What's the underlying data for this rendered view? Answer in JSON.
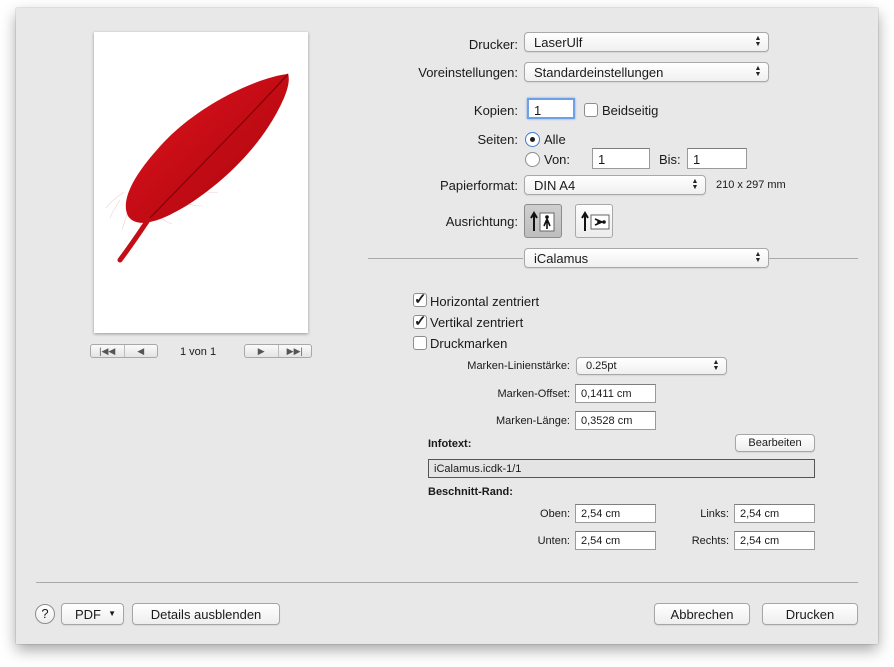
{
  "printer": {
    "label": "Drucker:",
    "value": "LaserUlf"
  },
  "presets": {
    "label": "Voreinstellungen:",
    "value": "Standardeinstellungen"
  },
  "copies": {
    "label": "Kopien:",
    "value": "1",
    "duplex_label": "Beidseitig",
    "duplex_checked": false
  },
  "pages": {
    "label": "Seiten:",
    "all_label": "Alle",
    "from_label": "Von:",
    "from_value": "1",
    "to_label": "Bis:",
    "to_value": "1",
    "selected": "all"
  },
  "paper": {
    "label": "Papierformat:",
    "value": "DIN A4",
    "size_text": "210 x 297 mm"
  },
  "orientation": {
    "label": "Ausrichtung:",
    "selected": "portrait"
  },
  "section_popup": {
    "value": "iCalamus"
  },
  "preview_nav": {
    "page_text": "1 von 1"
  },
  "options": {
    "horizontal_label": "Horizontal zentriert",
    "horizontal_checked": true,
    "vertical_label": "Vertikal zentriert",
    "vertical_checked": true,
    "marks_label": "Druckmarken",
    "marks_checked": false,
    "line_width_label": "Marken-Linienstärke:",
    "line_width_value": "0.25pt",
    "offset_label": "Marken-Offset:",
    "offset_value": "0,1411 cm",
    "length_label": "Marken-Länge:",
    "length_value": "0,3528 cm"
  },
  "infotext": {
    "label": "Infotext:",
    "edit_button": "Bearbeiten",
    "value": "iCalamus.icdk-1/1"
  },
  "bleed": {
    "label": "Beschnitt-Rand:",
    "top_label": "Oben:",
    "top_value": "2,54 cm",
    "left_label": "Links:",
    "left_value": "2,54 cm",
    "bottom_label": "Unten:",
    "bottom_value": "2,54 cm",
    "right_label": "Rechts:",
    "right_value": "2,54 cm"
  },
  "footer": {
    "help_label": "?",
    "pdf_label": "PDF",
    "details_label": "Details ausblenden",
    "cancel_label": "Abbrechen",
    "print_label": "Drucken"
  },
  "colors": {
    "accent": "#3b7bd8",
    "feather": "#d0101a"
  }
}
